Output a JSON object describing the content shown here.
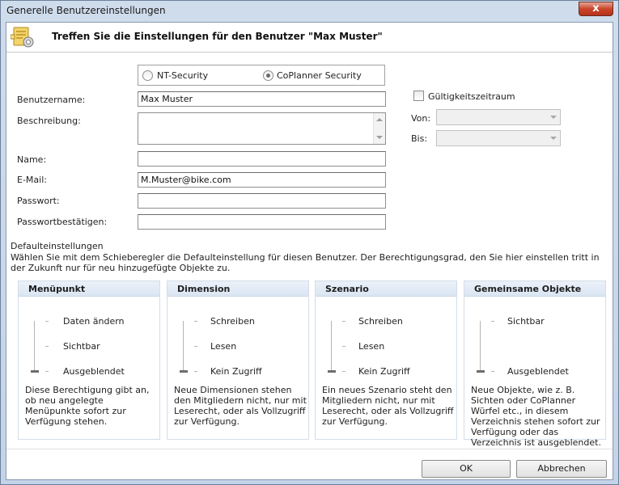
{
  "window": {
    "title": "Generelle Benutzereinstellungen",
    "close_glyph": "x"
  },
  "header": {
    "icon": "user-settings-icon",
    "title": "Treffen Sie die Einstellungen für den Benutzer \"Max Muster\""
  },
  "security": {
    "options": [
      {
        "label": "NT-Security",
        "checked": false
      },
      {
        "label": "CoPlanner Security",
        "checked": true
      }
    ]
  },
  "form": {
    "username_label": "Benutzername:",
    "username_value": "Max Muster",
    "description_label": "Beschreibung:",
    "description_value": "",
    "name_label": "Name:",
    "name_value": "",
    "email_label": "E-Mail:",
    "email_value": "M.Muster@bike.com",
    "password_label": "Passwort:",
    "password_value": "",
    "password_confirm_label": "Passwortbestätigen:",
    "password_confirm_value": ""
  },
  "validity": {
    "checkbox_label": "Gültigkeitszeitraum",
    "checked": false,
    "from_label": "Von:",
    "to_label": "Bis:"
  },
  "defaults": {
    "title": "Defaulteinstellungen",
    "description": "Wählen Sie mit dem Schieberegler die Defaulteinstellung für diesen Benutzer. Der Berechtigungsgrad, den Sie hier einstellen tritt in der Zukunft nur für neu hinzugefügte Objekte zu."
  },
  "panels": [
    {
      "title": "Menüpunkt",
      "levels": [
        "Daten ändern",
        "Sichtbar",
        "Ausgeblendet"
      ],
      "selected_index": 2,
      "description": "Diese Berechtigung gibt an, ob neu angelegte Menüpunkte sofort zur Verfügung stehen."
    },
    {
      "title": "Dimension",
      "levels": [
        "Schreiben",
        "Lesen",
        "Kein Zugriff"
      ],
      "selected_index": 2,
      "description": "Neue Dimensionen stehen den Mitgliedern nicht, nur mit Leserecht, oder als Vollzugriff zur Verfügung."
    },
    {
      "title": "Szenario",
      "levels": [
        "Schreiben",
        "Lesen",
        "Kein Zugriff"
      ],
      "selected_index": 2,
      "description": "Ein neues Szenario steht den Mitgliedern nicht, nur mit Leserecht, oder als Vollzugriff zur Verfügung."
    },
    {
      "title": "Gemeinsame Objekte",
      "levels": [
        "Sichtbar",
        "Ausgeblendet"
      ],
      "selected_index": 1,
      "description": "Neue Objekte, wie z. B. Sichten oder CoPlanner Würfel etc., in diesem Verzeichnis stehen sofort zur Verfügung oder das Verzeichnis ist ausgeblendet."
    }
  ],
  "buttons": {
    "ok": "OK",
    "cancel": "Abbrechen"
  },
  "colors": {
    "panel_header": "#dbe6f3",
    "close_button": "#c9462c"
  }
}
